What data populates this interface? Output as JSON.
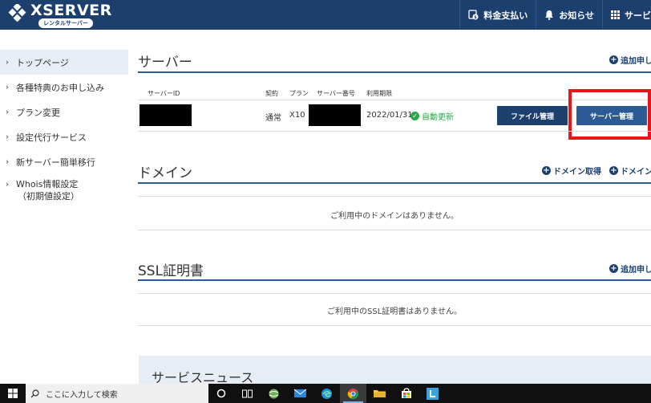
{
  "header": {
    "logo_text": "XSERVER",
    "logo_sub": "レンタルサーバー",
    "nav": [
      {
        "label": "料金支払い",
        "icon": "payment-icon"
      },
      {
        "label": "お知らせ",
        "icon": "bell-icon"
      },
      {
        "label": "サービ",
        "icon": "grid-icon"
      }
    ]
  },
  "sidebar": {
    "items": [
      {
        "label": "トップページ"
      },
      {
        "label": "各種特典のお申し込み"
      },
      {
        "label": "プラン変更"
      },
      {
        "label": "設定代行サービス"
      },
      {
        "label": "新サーバー簡単移行"
      },
      {
        "label": "Whois情報設定",
        "label2": "（初期値設定）"
      }
    ]
  },
  "server": {
    "title": "サーバー",
    "add_label": "追加申し",
    "headers": {
      "id": "サーバーID",
      "contract": "契約",
      "plan": "プラン",
      "number": "サーバー番号",
      "expiry": "利用期限"
    },
    "row": {
      "contract": "通常",
      "plan": "X10",
      "expiry": "2022/01/31",
      "auto_renew": "自動更新",
      "file_btn": "ファイル管理",
      "server_btn": "サーバー管理"
    }
  },
  "domain": {
    "title": "ドメイン",
    "acquire_label": "ドメイン取得",
    "other_label": "ドメイン",
    "empty": "ご利用中のドメインはありません。"
  },
  "ssl": {
    "title": "SSL証明書",
    "add_label": "追加申し",
    "empty": "ご利用中のSSL証明書はありません。"
  },
  "news": {
    "title": "サービスニュース"
  },
  "taskbar": {
    "search_placeholder": "ここに入力して検索"
  },
  "colors": {
    "header": "#1d3f6e",
    "accent": "#2c5a95",
    "highlight": "#e8161b",
    "success": "#2aa84a"
  }
}
